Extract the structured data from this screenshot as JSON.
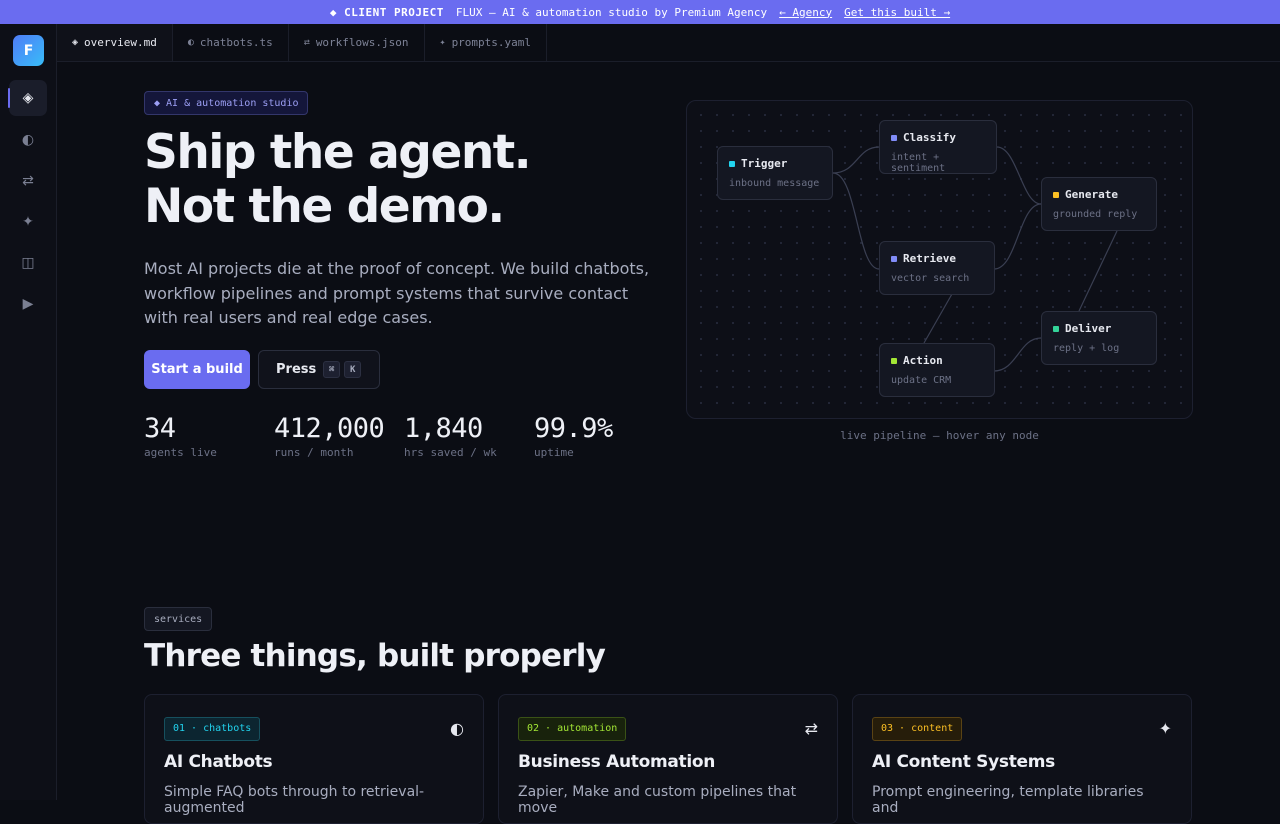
{
  "banner": {
    "label": "◆ CLIENT PROJECT",
    "text": "FLUX — AI & automation studio by Premium Agency",
    "link_agency": "← Agency",
    "link_build": "Get this built →"
  },
  "sidebar": {
    "logo": "F",
    "items": [
      {
        "icon": "◈",
        "name": "overview"
      },
      {
        "icon": "◐",
        "name": "chatbots"
      },
      {
        "icon": "⇄",
        "name": "workflows"
      },
      {
        "icon": "✦",
        "name": "prompts"
      },
      {
        "icon": "◫",
        "name": "panels"
      },
      {
        "icon": "▶",
        "name": "run"
      }
    ]
  },
  "tabs": [
    {
      "icon": "◈",
      "label": "overview.md"
    },
    {
      "icon": "◐",
      "label": "chatbots.ts"
    },
    {
      "icon": "⇄",
      "label": "workflows.json"
    },
    {
      "icon": "✦",
      "label": "prompts.yaml"
    }
  ],
  "hero": {
    "pill_icon": "◆",
    "pill": "AI & automation studio",
    "title_line1": "Ship the agent.",
    "title_line2": "Not the demo.",
    "lede": "Most AI projects die at the proof of concept. We build chatbots, workflow pipelines and prompt systems that survive contact with real users and real edge cases.",
    "cta_primary": "Start a build",
    "cta_secondary": "Press",
    "kbd1": "⌘",
    "kbd2": "K"
  },
  "stats": [
    {
      "value": "34",
      "label": "agents live"
    },
    {
      "value": "412,000",
      "label": "runs / month"
    },
    {
      "value": "1,840",
      "label": "hrs saved / wk"
    },
    {
      "value": "99.9%",
      "label": "uptime"
    }
  ],
  "pipeline": {
    "caption": "live pipeline — hover any node",
    "nodes": [
      {
        "title": "Trigger",
        "sub": "inbound message",
        "color": "#22d3ee"
      },
      {
        "title": "Classify",
        "sub": "intent + sentiment",
        "color": "#818cf8"
      },
      {
        "title": "Generate",
        "sub": "grounded reply",
        "color": "#fbbf24"
      },
      {
        "title": "Retrieve",
        "sub": "vector search",
        "color": "#818cf8"
      },
      {
        "title": "Deliver",
        "sub": "reply + log",
        "color": "#34d399"
      },
      {
        "title": "Action",
        "sub": "update CRM",
        "color": "#a3e635"
      }
    ]
  },
  "services": {
    "pill": "services",
    "title": "Three things, built properly",
    "cards": [
      {
        "tag": "01 · chatbots",
        "icon": "◐",
        "title": "AI Chatbots",
        "desc": "Simple FAQ bots through to retrieval-augmented",
        "tag_color": "#22d3ee",
        "tag_bg": "#0c2530",
        "tag_border": "#16505e"
      },
      {
        "tag": "02 · automation",
        "icon": "⇄",
        "title": "Business Automation",
        "desc": "Zapier, Make and custom pipelines that move",
        "tag_color": "#a3e635",
        "tag_bg": "#18220c",
        "tag_border": "#3a5216"
      },
      {
        "tag": "03 · content",
        "icon": "✦",
        "title": "AI Content Systems",
        "desc": "Prompt engineering, template libraries and",
        "tag_color": "#fbbf24",
        "tag_bg": "#261d0a",
        "tag_border": "#5a4314"
      }
    ]
  }
}
